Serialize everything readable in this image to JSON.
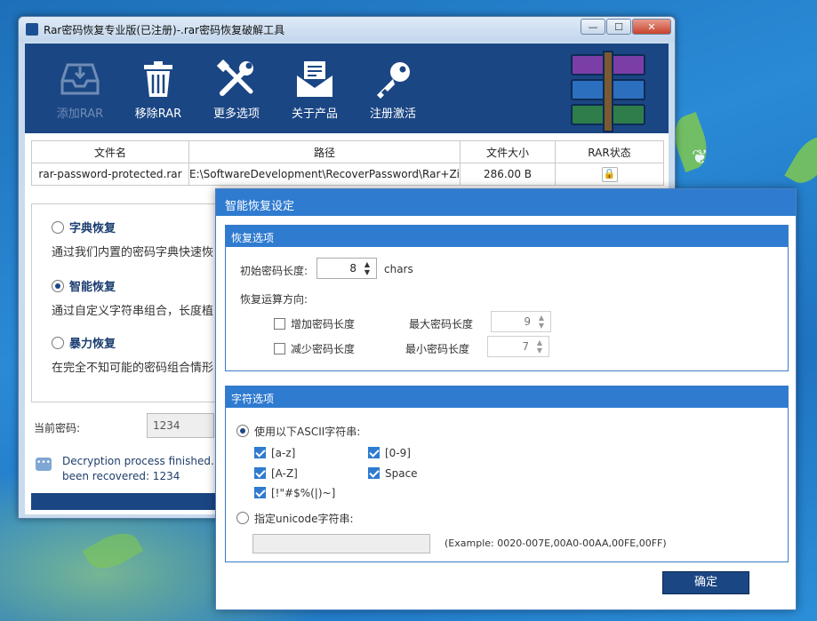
{
  "main_window": {
    "title": "Rar密码恢复专业版(已注册)-.rar密码恢复破解工具",
    "controls": {
      "minimize": "—",
      "maximize": "☐",
      "close": "✕"
    }
  },
  "toolbar": {
    "items": [
      {
        "label": "添加RAR",
        "icon": "inbox-icon",
        "enabled": false
      },
      {
        "label": "移除RAR",
        "icon": "trash-icon",
        "enabled": true
      },
      {
        "label": "更多选项",
        "icon": "tools-icon",
        "enabled": true
      },
      {
        "label": "关于产品",
        "icon": "envelope-icon",
        "enabled": true
      },
      {
        "label": "注册激活",
        "icon": "key-icon",
        "enabled": true
      }
    ]
  },
  "file_table": {
    "headers": [
      "文件名",
      "路径",
      "文件大小",
      "RAR状态"
    ],
    "rows": [
      {
        "name": "rar-password-protected.rar",
        "path": "E:\\SoftwareDevelopment\\RecoverPassword\\Rar+Zi",
        "size": "286.00 B",
        "status_icon": "lock-icon"
      }
    ]
  },
  "modes": [
    {
      "title": "字典恢复",
      "desc": "通过我们内置的密码字典快速恢",
      "selected": false
    },
    {
      "title": "智能恢复",
      "desc": "通过自定义字符串组合，长度植",
      "selected": true
    },
    {
      "title": "暴力恢复",
      "desc": "在完全不知可能的密码组合情形",
      "selected": false
    }
  ],
  "current_password": {
    "label": "当前密码:",
    "value": "1234"
  },
  "message": {
    "line1": "Decryption process finished. Y",
    "line2": "been recovered: 1234"
  },
  "dialog": {
    "title": "智能恢复设定",
    "recovery_group": {
      "title": "恢复选项",
      "initial_length_label": "初始密码长度:",
      "initial_length_value": "8",
      "initial_length_unit": "chars",
      "direction_label": "恢复运算方向:",
      "increase_label": "增加密码长度",
      "increase_checked": false,
      "max_label": "最大密码长度",
      "max_value": "9",
      "decrease_label": "减少密码长度",
      "decrease_checked": false,
      "min_label": "最小密码长度",
      "min_value": "7"
    },
    "charset_group": {
      "title": "字符选项",
      "ascii_label": "使用以下ASCII字符串:",
      "ascii_selected": true,
      "options": [
        {
          "label": "[a-z]",
          "checked": true
        },
        {
          "label": "[0-9]",
          "checked": true
        },
        {
          "label": "[A-Z]",
          "checked": true
        },
        {
          "label": "Space",
          "checked": true
        },
        {
          "label": "[!\"#$%(|)~]",
          "checked": true
        }
      ],
      "unicode_label": "指定unicode字符串:",
      "unicode_selected": false,
      "unicode_value": "",
      "unicode_example": "(Example: 0020-007E,00A0-00AA,00FE,00FF)"
    },
    "ok_label": "确定"
  },
  "colors": {
    "toolbar_bg": "#1b4684",
    "dialog_accent": "#2f7bd0",
    "desktop_bg": "#1e73c2"
  }
}
